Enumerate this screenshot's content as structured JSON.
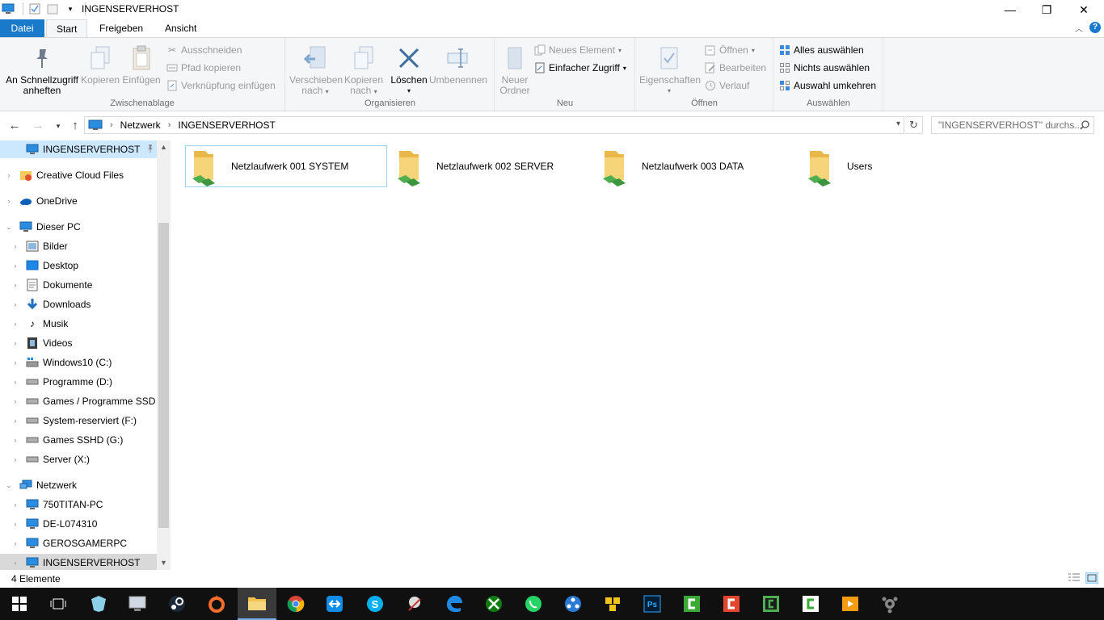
{
  "window": {
    "title": "INGENSERVERHOST",
    "minimize_glyph": "—",
    "maximize_glyph": "❐",
    "close_glyph": "✕"
  },
  "ribbon_tabs": {
    "file": "Datei",
    "start": "Start",
    "share": "Freigeben",
    "view": "Ansicht",
    "help": "?"
  },
  "ribbon": {
    "clipboard": {
      "label": "Zwischenablage",
      "pin_line1": "An Schnellzugriff",
      "pin_line2": "anheften",
      "copy": "Kopieren",
      "paste": "Einfügen",
      "cut": "Ausschneiden",
      "copy_path": "Pfad kopieren",
      "paste_shortcut": "Verknüpfung einfügen"
    },
    "organize": {
      "label": "Organisieren",
      "move_line1": "Verschieben",
      "move_line2": "nach",
      "copyto_line1": "Kopieren",
      "copyto_line2": "nach",
      "delete": "Löschen",
      "rename": "Umbenennen"
    },
    "new": {
      "label": "Neu",
      "folder_line1": "Neuer",
      "folder_line2": "Ordner",
      "new_item": "Neues Element",
      "easy_access": "Einfacher Zugriff"
    },
    "open": {
      "label": "Öffnen",
      "properties": "Eigenschaften",
      "open": "Öffnen",
      "edit": "Bearbeiten",
      "history": "Verlauf"
    },
    "select": {
      "label": "Auswählen",
      "select_all": "Alles auswählen",
      "select_none": "Nichts auswählen",
      "invert": "Auswahl umkehren"
    }
  },
  "address": {
    "crumbs": [
      "Netzwerk",
      "INGENSERVERHOST"
    ],
    "search_placeholder": "\"INGENSERVERHOST\" durchs..."
  },
  "nav_pane": [
    "INGENSERVERHOST",
    "Creative Cloud Files",
    "OneDrive",
    "Dieser PC",
    "Bilder",
    "Desktop",
    "Dokumente",
    "Downloads",
    "Musik",
    "Videos",
    "Windows10 (C:)",
    "Programme (D:)",
    "Games / Programme SSD (",
    "System-reserviert (F:)",
    "Games SSHD (G:)",
    "Server (X:)",
    "Netzwerk",
    "750TITAN-PC",
    "DE-L074310",
    "GEROSGAMERPC",
    "INGENSERVERHOST"
  ],
  "files": [
    "Netzlaufwerk 001 SYSTEM",
    "Netzlaufwerk 002 SERVER",
    "Netzlaufwerk 003 DATA",
    "Users"
  ],
  "status": {
    "count": "4 Elemente"
  },
  "colors": {
    "accent": "#1979ca",
    "selection": "#cce8ff",
    "taskbar": "#101010"
  }
}
